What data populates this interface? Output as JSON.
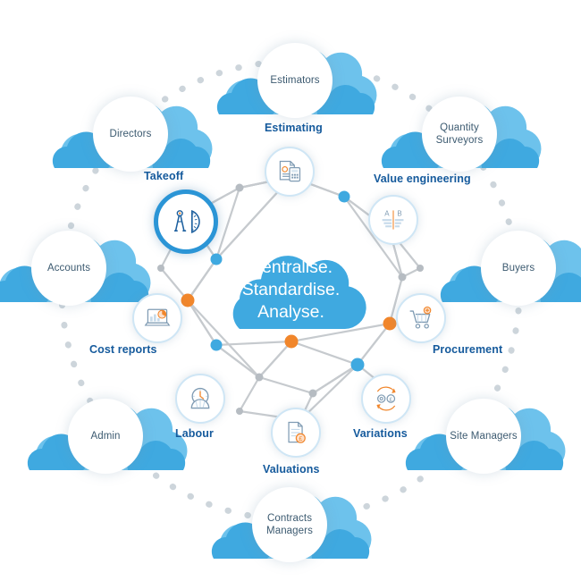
{
  "diagram": {
    "center": {
      "lines": [
        "Centralise.",
        "Standardise.",
        "Analyse."
      ]
    },
    "roles": [
      {
        "label": "Estimators",
        "icon": "cloud-icon"
      },
      {
        "label": "Quantity Surveyors",
        "icon": "cloud-icon"
      },
      {
        "label": "Buyers",
        "icon": "cloud-icon"
      },
      {
        "label": "Site Managers",
        "icon": "cloud-icon"
      },
      {
        "label": "Contracts Managers",
        "icon": "cloud-icon"
      },
      {
        "label": "Admin",
        "icon": "cloud-icon"
      },
      {
        "label": "Accounts",
        "icon": "cloud-icon"
      },
      {
        "label": "Directors",
        "icon": "cloud-icon"
      }
    ],
    "features": [
      {
        "label": "Estimating",
        "icon": "invoice-calculator-icon"
      },
      {
        "label": "Value engineering",
        "icon": "ab-compare-icon"
      },
      {
        "label": "Procurement",
        "icon": "shopping-cart-icon"
      },
      {
        "label": "Variations",
        "icon": "gear-pound-exchange-icon"
      },
      {
        "label": "Valuations",
        "icon": "document-pound-coin-icon"
      },
      {
        "label": "Labour",
        "icon": "clock-hardhat-icon"
      },
      {
        "label": "Cost reports",
        "icon": "laptop-chart-icon"
      },
      {
        "label": "Takeoff",
        "icon": "compass-protractor-icon"
      }
    ],
    "colors": {
      "cloud_blue": "#3fa9e0",
      "cloud_blue_dark": "#2b95d6",
      "label_blue": "#155a9c",
      "role_text": "#3c5a70",
      "node_orange": "#f1862b",
      "node_blue": "#3fa9e0",
      "node_grey": "#b6bcc2",
      "edge_grey": "#c3c8cc",
      "icon_outline": "#7f9bb3",
      "icon_accent": "#f1862b",
      "dot_ring": "#cdd5db"
    }
  }
}
